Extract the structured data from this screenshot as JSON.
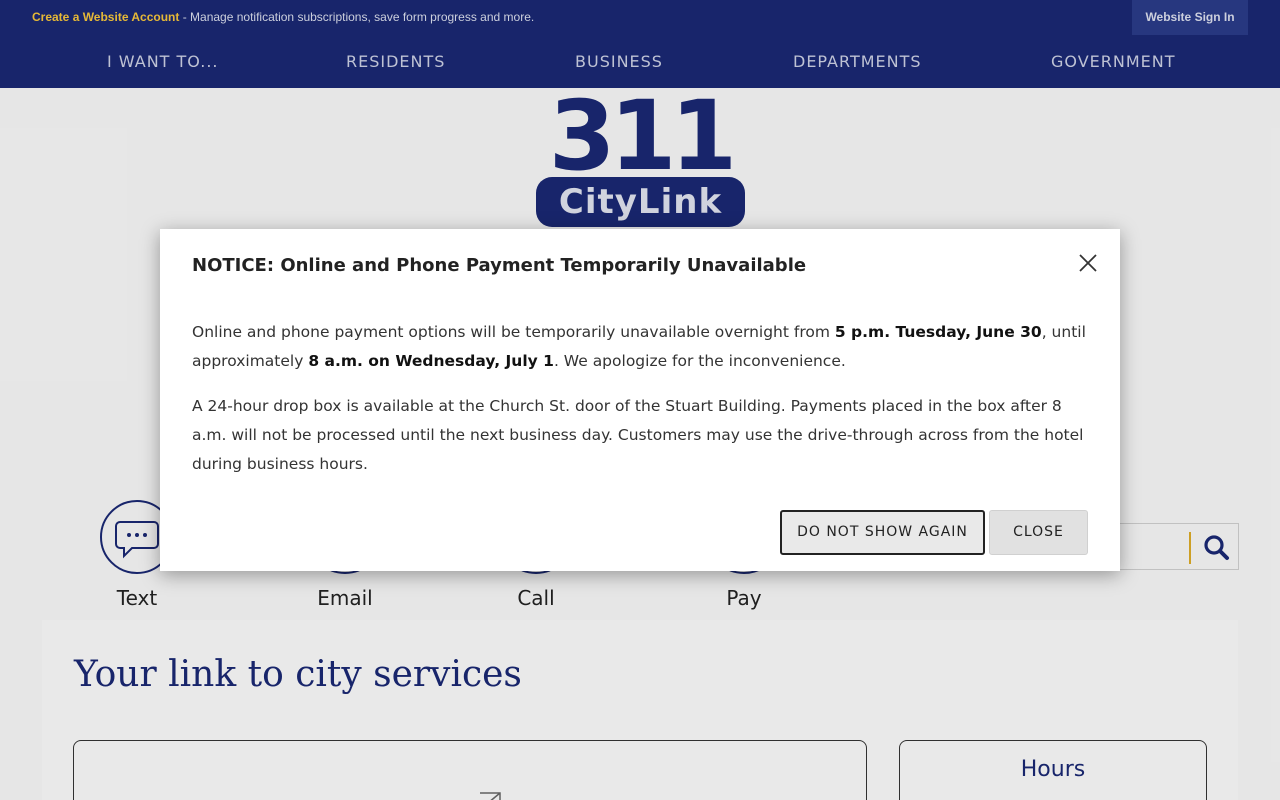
{
  "topbar": {
    "account_link": "Create a Website Account",
    "account_text": " - Manage notification subscriptions, save form progress and more.",
    "signin_label": "Website Sign In"
  },
  "nav": {
    "items": [
      "I WANT TO...",
      "RESIDENTS",
      "BUSINESS",
      "DEPARTMENTS",
      "GOVERNMENT"
    ]
  },
  "logo": {
    "number": "311",
    "name": "CityLink"
  },
  "quick_links": [
    {
      "label": "Text",
      "icon": "chat-bubble-icon"
    },
    {
      "label": "Email",
      "icon": "email-icon"
    },
    {
      "label": "Call",
      "icon": "phone-icon"
    },
    {
      "label": "Pay",
      "icon": "pay-icon"
    }
  ],
  "search": {
    "icon": "search-icon"
  },
  "content": {
    "tagline": "Your link to city services",
    "hours_heading": "Hours"
  },
  "modal": {
    "title": "NOTICE: Online and Phone Payment Temporarily Unavailable",
    "p1_a": "Online and phone payment options will be temporarily unavailable overnight from ",
    "p1_b": "5 p.m. Tuesday, June 30",
    "p1_c": ", until approximately ",
    "p1_d": "8 a.m. on Wednesday, July 1",
    "p1_e": ". We apologize for the inconvenience.",
    "p2": "A 24-hour drop box is available at the Church St. door of the Stuart Building. Payments placed in the box after 8 a.m. will not be processed until the next business day. Customers may use the drive-through across from the hotel during business hours.",
    "do_not_show_label": "DO NOT SHOW AGAIN",
    "close_label": "CLOSE"
  },
  "colors": {
    "brand_navy": "#1a2871",
    "accent_gold": "#f2c23a"
  }
}
